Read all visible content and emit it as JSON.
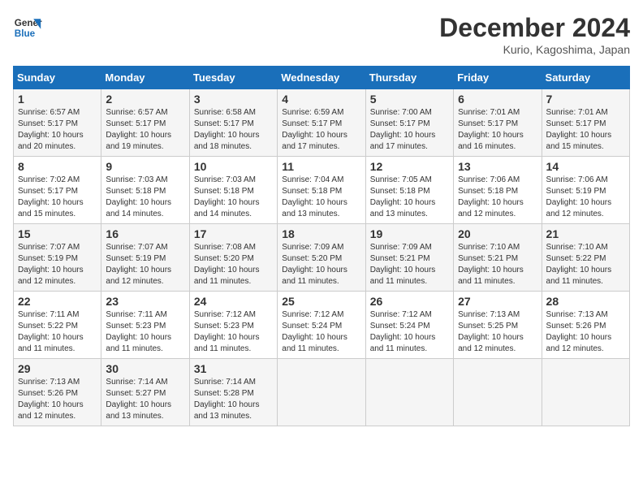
{
  "logo": {
    "line1": "General",
    "line2": "Blue"
  },
  "title": "December 2024",
  "subtitle": "Kurio, Kagoshima, Japan",
  "weekdays": [
    "Sunday",
    "Monday",
    "Tuesday",
    "Wednesday",
    "Thursday",
    "Friday",
    "Saturday"
  ],
  "weeks": [
    [
      {
        "day": "1",
        "info": "Sunrise: 6:57 AM\nSunset: 5:17 PM\nDaylight: 10 hours\nand 20 minutes."
      },
      {
        "day": "2",
        "info": "Sunrise: 6:57 AM\nSunset: 5:17 PM\nDaylight: 10 hours\nand 19 minutes."
      },
      {
        "day": "3",
        "info": "Sunrise: 6:58 AM\nSunset: 5:17 PM\nDaylight: 10 hours\nand 18 minutes."
      },
      {
        "day": "4",
        "info": "Sunrise: 6:59 AM\nSunset: 5:17 PM\nDaylight: 10 hours\nand 17 minutes."
      },
      {
        "day": "5",
        "info": "Sunrise: 7:00 AM\nSunset: 5:17 PM\nDaylight: 10 hours\nand 17 minutes."
      },
      {
        "day": "6",
        "info": "Sunrise: 7:01 AM\nSunset: 5:17 PM\nDaylight: 10 hours\nand 16 minutes."
      },
      {
        "day": "7",
        "info": "Sunrise: 7:01 AM\nSunset: 5:17 PM\nDaylight: 10 hours\nand 15 minutes."
      }
    ],
    [
      {
        "day": "8",
        "info": "Sunrise: 7:02 AM\nSunset: 5:17 PM\nDaylight: 10 hours\nand 15 minutes."
      },
      {
        "day": "9",
        "info": "Sunrise: 7:03 AM\nSunset: 5:18 PM\nDaylight: 10 hours\nand 14 minutes."
      },
      {
        "day": "10",
        "info": "Sunrise: 7:03 AM\nSunset: 5:18 PM\nDaylight: 10 hours\nand 14 minutes."
      },
      {
        "day": "11",
        "info": "Sunrise: 7:04 AM\nSunset: 5:18 PM\nDaylight: 10 hours\nand 13 minutes."
      },
      {
        "day": "12",
        "info": "Sunrise: 7:05 AM\nSunset: 5:18 PM\nDaylight: 10 hours\nand 13 minutes."
      },
      {
        "day": "13",
        "info": "Sunrise: 7:06 AM\nSunset: 5:18 PM\nDaylight: 10 hours\nand 12 minutes."
      },
      {
        "day": "14",
        "info": "Sunrise: 7:06 AM\nSunset: 5:19 PM\nDaylight: 10 hours\nand 12 minutes."
      }
    ],
    [
      {
        "day": "15",
        "info": "Sunrise: 7:07 AM\nSunset: 5:19 PM\nDaylight: 10 hours\nand 12 minutes."
      },
      {
        "day": "16",
        "info": "Sunrise: 7:07 AM\nSunset: 5:19 PM\nDaylight: 10 hours\nand 12 minutes."
      },
      {
        "day": "17",
        "info": "Sunrise: 7:08 AM\nSunset: 5:20 PM\nDaylight: 10 hours\nand 11 minutes."
      },
      {
        "day": "18",
        "info": "Sunrise: 7:09 AM\nSunset: 5:20 PM\nDaylight: 10 hours\nand 11 minutes."
      },
      {
        "day": "19",
        "info": "Sunrise: 7:09 AM\nSunset: 5:21 PM\nDaylight: 10 hours\nand 11 minutes."
      },
      {
        "day": "20",
        "info": "Sunrise: 7:10 AM\nSunset: 5:21 PM\nDaylight: 10 hours\nand 11 minutes."
      },
      {
        "day": "21",
        "info": "Sunrise: 7:10 AM\nSunset: 5:22 PM\nDaylight: 10 hours\nand 11 minutes."
      }
    ],
    [
      {
        "day": "22",
        "info": "Sunrise: 7:11 AM\nSunset: 5:22 PM\nDaylight: 10 hours\nand 11 minutes."
      },
      {
        "day": "23",
        "info": "Sunrise: 7:11 AM\nSunset: 5:23 PM\nDaylight: 10 hours\nand 11 minutes."
      },
      {
        "day": "24",
        "info": "Sunrise: 7:12 AM\nSunset: 5:23 PM\nDaylight: 10 hours\nand 11 minutes."
      },
      {
        "day": "25",
        "info": "Sunrise: 7:12 AM\nSunset: 5:24 PM\nDaylight: 10 hours\nand 11 minutes."
      },
      {
        "day": "26",
        "info": "Sunrise: 7:12 AM\nSunset: 5:24 PM\nDaylight: 10 hours\nand 11 minutes."
      },
      {
        "day": "27",
        "info": "Sunrise: 7:13 AM\nSunset: 5:25 PM\nDaylight: 10 hours\nand 12 minutes."
      },
      {
        "day": "28",
        "info": "Sunrise: 7:13 AM\nSunset: 5:26 PM\nDaylight: 10 hours\nand 12 minutes."
      }
    ],
    [
      {
        "day": "29",
        "info": "Sunrise: 7:13 AM\nSunset: 5:26 PM\nDaylight: 10 hours\nand 12 minutes."
      },
      {
        "day": "30",
        "info": "Sunrise: 7:14 AM\nSunset: 5:27 PM\nDaylight: 10 hours\nand 13 minutes."
      },
      {
        "day": "31",
        "info": "Sunrise: 7:14 AM\nSunset: 5:28 PM\nDaylight: 10 hours\nand 13 minutes."
      },
      {
        "day": "",
        "info": ""
      },
      {
        "day": "",
        "info": ""
      },
      {
        "day": "",
        "info": ""
      },
      {
        "day": "",
        "info": ""
      }
    ]
  ]
}
